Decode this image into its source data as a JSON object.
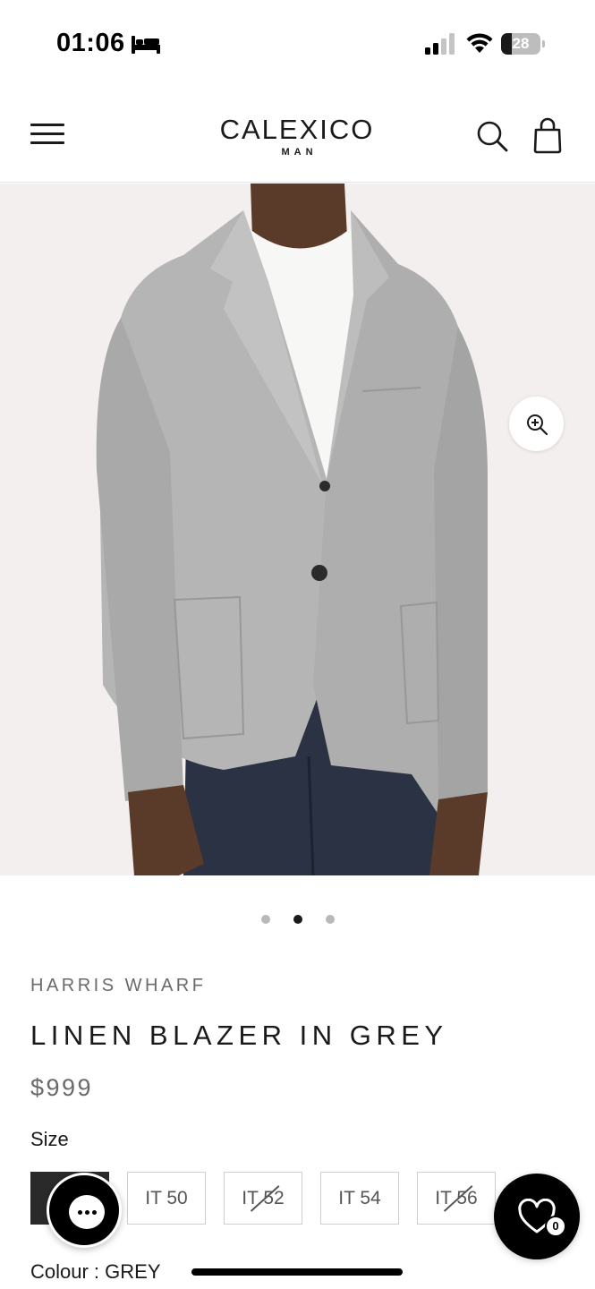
{
  "status_bar": {
    "time": "01:06",
    "battery_level": "28",
    "battery_fraction": 0.28,
    "icons": [
      "bed-icon",
      "signal-icon",
      "wifi-icon",
      "battery-icon"
    ]
  },
  "header": {
    "logo_main": "CALEXICO",
    "logo_sub": "MAN",
    "icons": [
      "menu-icon",
      "search-icon",
      "bag-icon"
    ]
  },
  "gallery": {
    "slide_count": 3,
    "active_slide": 2,
    "zoom_icon": "zoom-in-icon"
  },
  "product": {
    "brand": "HARRIS WHARF",
    "title": "LINEN BLAZER IN GREY",
    "price": "$999",
    "size_label": "Size",
    "sizes": [
      {
        "label": "",
        "selected": true,
        "available": true
      },
      {
        "label": "IT 50",
        "selected": false,
        "available": true
      },
      {
        "label": "IT 52",
        "selected": false,
        "available": false
      },
      {
        "label": "IT 54",
        "selected": false,
        "available": true
      },
      {
        "label": "IT 56",
        "selected": false,
        "available": false
      }
    ],
    "colour_line": "Colour : GREY"
  },
  "floating": {
    "chat_icon": "chat-icon",
    "wishlist_icon": "heart-icon",
    "wishlist_count": "0"
  },
  "colors": {
    "background": "#ffffff",
    "image_background": "#f3efee",
    "text_primary": "#1a1a1a",
    "text_muted": "#6a6a6a",
    "selected_size": "#2a2a2a",
    "floating_button": "#000000"
  }
}
